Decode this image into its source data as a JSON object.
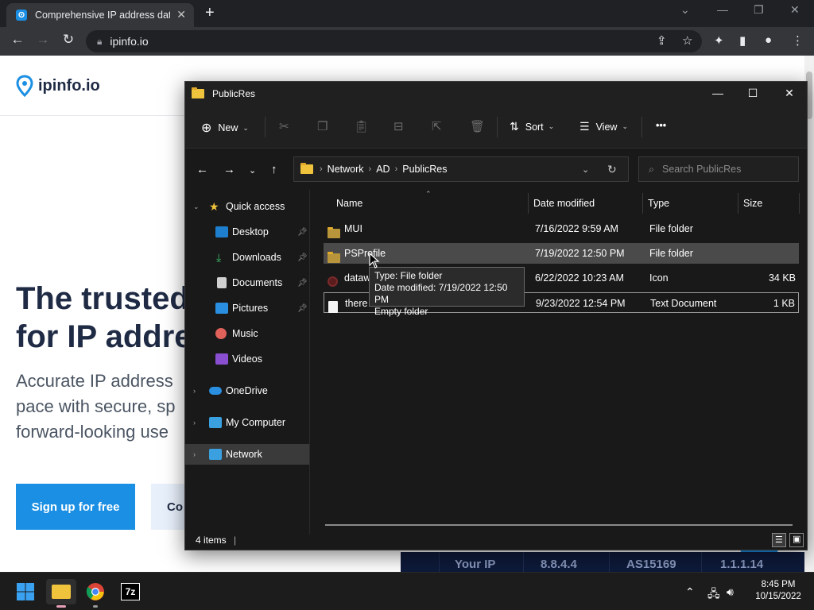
{
  "browser": {
    "tab_title": "Comprehensive IP address data, I",
    "tab_close": "✕",
    "new_tab": "+",
    "url": "ipinfo.io",
    "win_minimize": "—",
    "win_restore": "❐",
    "win_close": "✕",
    "tab_search": "⌄"
  },
  "website": {
    "logo_text": "ipinfo.io",
    "headline_line1": "The trusted",
    "headline_line2": "for IP addre",
    "sub_line1": "Accurate IP address",
    "sub_line2": "pace with secure, sp",
    "sub_line3": "forward-looking use",
    "signup_label": "Sign up for free",
    "second_cta_label": "Co",
    "sample_table": {
      "your_ip_label": "Your IP",
      "ip_value": "8.8.4.4",
      "asn_value": "AS15169",
      "version_value": "1.1.1.14"
    }
  },
  "explorer": {
    "title": "PublicRes",
    "toolbar": {
      "new_label": "New",
      "sort_label": "Sort",
      "view_label": "View",
      "more_label": "•••"
    },
    "address": {
      "crumbs": [
        "Network",
        "AD",
        "PublicRes"
      ],
      "search_placeholder": "Search PublicRes"
    },
    "nav": {
      "quick_access": "Quick access",
      "desktop": "Desktop",
      "downloads": "Downloads",
      "documents": "Documents",
      "pictures": "Pictures",
      "music": "Music",
      "videos": "Videos",
      "onedrive": "OneDrive",
      "my_computer": "My Computer",
      "network": "Network"
    },
    "columns": {
      "name": "Name",
      "date": "Date modified",
      "type": "Type",
      "size": "Size"
    },
    "files": [
      {
        "name": "MUI",
        "date": "7/16/2022 9:59 AM",
        "type": "File folder",
        "size": ""
      },
      {
        "name": "PSProfile",
        "date": "7/19/2022 12:50 PM",
        "type": "File folder",
        "size": ""
      },
      {
        "name": "dataw",
        "date": "6/22/2022 10:23 AM",
        "type": "Icon",
        "size": "34 KB"
      },
      {
        "name": "there i",
        "date": "9/23/2022 12:54 PM",
        "type": "Text Document",
        "size": "1 KB"
      }
    ],
    "tooltip": {
      "line1": "Type: File folder",
      "line2": "Date modified: 7/19/2022 12:50 PM",
      "line3": "Empty folder"
    },
    "status_items": "4 items"
  },
  "taskbar": {
    "time": "8:45 PM",
    "date": "10/15/2022",
    "sevenzip_label": "7z"
  }
}
